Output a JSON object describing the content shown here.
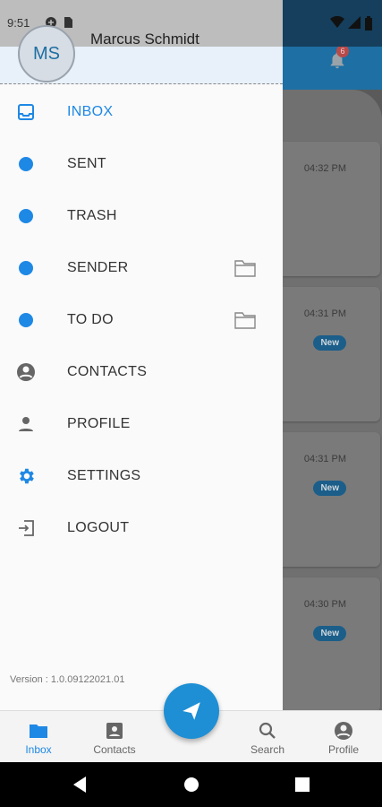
{
  "status_bar": {
    "time": "9:51"
  },
  "user": {
    "initials": "MS",
    "name": "Marcus Schmidt"
  },
  "notifications": {
    "count": "6"
  },
  "menu": {
    "items": [
      {
        "label": "INBOX",
        "icon": "inbox-icon",
        "active": true
      },
      {
        "label": "SENT",
        "icon": "dot-icon"
      },
      {
        "label": "TRASH",
        "icon": "dot-icon"
      },
      {
        "label": "SENDER",
        "icon": "dot-icon",
        "folder": true
      },
      {
        "label": "TO DO",
        "icon": "dot-icon",
        "folder": true
      },
      {
        "label": "CONTACTS",
        "icon": "account-circle-icon"
      },
      {
        "label": "PROFILE",
        "icon": "person-icon"
      },
      {
        "label": "SETTINGS",
        "icon": "gear-icon"
      },
      {
        "label": "LOGOUT",
        "icon": "logout-icon"
      }
    ]
  },
  "version": "Version : 1.0.09122021.01",
  "background_list": {
    "items": [
      {
        "time": "04:32 PM",
        "badge": ""
      },
      {
        "time": "04:31 PM",
        "badge": "New"
      },
      {
        "time": "04:31 PM",
        "badge": "New"
      },
      {
        "time": "04:30 PM",
        "badge": "New"
      }
    ]
  },
  "bottom_nav": {
    "inbox": "Inbox",
    "contacts": "Contacts",
    "search": "Search",
    "profile": "Profile"
  },
  "colors": {
    "accent": "#1e88e5",
    "header": "#1e6fa3",
    "fab": "#1e8fd5"
  }
}
